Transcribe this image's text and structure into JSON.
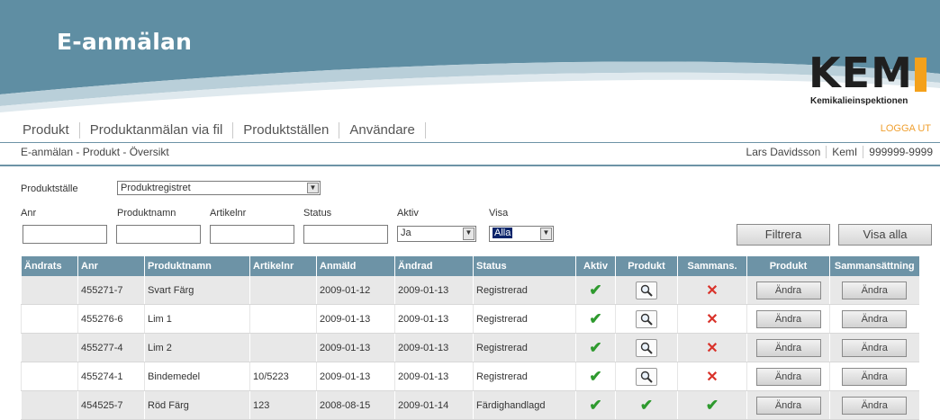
{
  "app": {
    "title": "E-anmälan"
  },
  "logo": {
    "text": "KEM",
    "subtitle": "Kemikalieinspektionen"
  },
  "nav": {
    "items": [
      "Produkt",
      "Produktanmälan via fil",
      "Produktställen",
      "Användare"
    ],
    "logout": "LOGGA UT"
  },
  "breadcrumb": "E-anmälan - Produkt - Översikt",
  "user": {
    "name": "Lars Davidsson",
    "org": "KemI",
    "number": "999999-9999"
  },
  "filters": {
    "produktstalle_label": "Produktställe",
    "produktstalle_value": "Produktregistret",
    "anr_label": "Anr",
    "produktnamn_label": "Produktnamn",
    "artikelnr_label": "Artikelnr",
    "status_label": "Status",
    "aktiv_label": "Aktiv",
    "aktiv_value": "Ja",
    "visa_label": "Visa",
    "visa_value": "Alla",
    "filter_button": "Filtrera",
    "show_all_button": "Visa alla"
  },
  "table": {
    "columns": [
      "Ändrats",
      "Anr",
      "Produktnamn",
      "Artikelnr",
      "Anmäld",
      "Ändrad",
      "Status",
      "Aktiv",
      "Produkt",
      "Sammans.",
      "Produkt",
      "Sammansättning"
    ],
    "edit_label": "Ändra",
    "rows": [
      {
        "andrats": "",
        "anr": "455271-7",
        "produktnamn": "Svart Färg",
        "artikelnr": "",
        "anmald": "2009-01-12",
        "andrad": "2009-01-13",
        "status": "Registrerad",
        "aktiv": "check",
        "produkt": "magnifier",
        "sammans": "cross"
      },
      {
        "andrats": "",
        "anr": "455276-6",
        "produktnamn": "Lim 1",
        "artikelnr": "",
        "anmald": "2009-01-13",
        "andrad": "2009-01-13",
        "status": "Registrerad",
        "aktiv": "check",
        "produkt": "magnifier",
        "sammans": "cross"
      },
      {
        "andrats": "",
        "anr": "455277-4",
        "produktnamn": "Lim 2",
        "artikelnr": "",
        "anmald": "2009-01-13",
        "andrad": "2009-01-13",
        "status": "Registrerad",
        "aktiv": "check",
        "produkt": "magnifier",
        "sammans": "cross"
      },
      {
        "andrats": "",
        "anr": "455274-1",
        "produktnamn": "Bindemedel",
        "artikelnr": "10/5223",
        "anmald": "2009-01-13",
        "andrad": "2009-01-13",
        "status": "Registrerad",
        "aktiv": "check",
        "produkt": "magnifier",
        "sammans": "cross"
      },
      {
        "andrats": "",
        "anr": "454525-7",
        "produktnamn": "Röd Färg",
        "artikelnr": "123",
        "anmald": "2008-08-15",
        "andrad": "2009-01-14",
        "status": "Färdighandlagd",
        "aktiv": "check",
        "produkt": "check",
        "sammans": "check"
      }
    ]
  },
  "colors": {
    "header": "#6d93a6",
    "banner": "#5f8ea3",
    "accent": "#f4a11b",
    "logout": "#f0a030",
    "check": "#2e9a2e",
    "cross": "#d9322a"
  }
}
